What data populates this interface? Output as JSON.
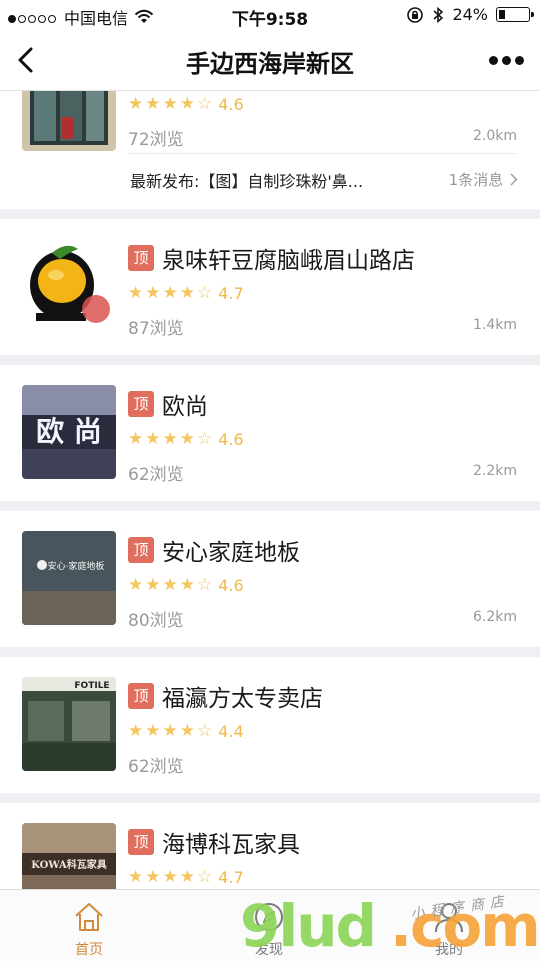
{
  "status_bar": {
    "carrier": "中国电信",
    "time": "下午9:58",
    "battery": "24%",
    "battery_level": 0.24
  },
  "nav": {
    "title": "手边西海岸新区"
  },
  "colors": {
    "accent": "#e06e5e",
    "star": "#f3c75e",
    "tab_active": "#d08b3c",
    "watermark_green": "#8dd65a",
    "watermark_orange": "#f6a43a"
  },
  "shops": [
    {
      "name": "",
      "top": false,
      "stars": "★★★★☆",
      "rating": "4.6",
      "views": "72浏览",
      "distance": "2.0km",
      "news": "最新发布:【图】自制珍珠粉'鼻...",
      "news_count": "1条消息",
      "thumb_icon": "storefront-photo"
    },
    {
      "name": "泉味轩豆腐脑峨眉山路店",
      "top": true,
      "top_label": "顶",
      "stars": "★★★★☆",
      "rating": "4.7",
      "views": "87浏览",
      "distance": "1.4km",
      "thumb_icon": "tofu-logo"
    },
    {
      "name": "欧尚",
      "top": true,
      "top_label": "顶",
      "stars": "★★★★☆",
      "rating": "4.6",
      "views": "62浏览",
      "distance": "2.2km",
      "thumb_icon": "store-sign-photo"
    },
    {
      "name": "安心家庭地板",
      "top": true,
      "top_label": "顶",
      "stars": "★★★★☆",
      "rating": "4.6",
      "views": "80浏览",
      "distance": "6.2km",
      "thumb_icon": "store-wall-photo"
    },
    {
      "name": "福瀛方太专卖店",
      "top": true,
      "top_label": "顶",
      "stars": "★★★★☆",
      "rating": "4.4",
      "views": "62浏览",
      "distance": "",
      "thumb_icon": "showroom-photo"
    },
    {
      "name": "海博科瓦家具",
      "top": true,
      "top_label": "顶",
      "stars": "★★★★☆",
      "rating": "4.7",
      "views": "",
      "distance": "",
      "thumb_icon": "furniture-photo"
    }
  ],
  "thumb_texts": {
    "oushang": "欧 尚",
    "anxin": "安心·家庭地板",
    "fotile": "FOTILE",
    "kowa": "KOWA科瓦家具"
  },
  "tabs": [
    {
      "label": "首页",
      "icon": "home-icon",
      "active": true
    },
    {
      "label": "发现",
      "icon": "compass-icon",
      "active": false
    },
    {
      "label": "我的",
      "icon": "user-icon",
      "active": false
    }
  ],
  "watermark": {
    "text_green": "9lud",
    "text_orange": ".com",
    "handwriting": "小程序商店"
  }
}
